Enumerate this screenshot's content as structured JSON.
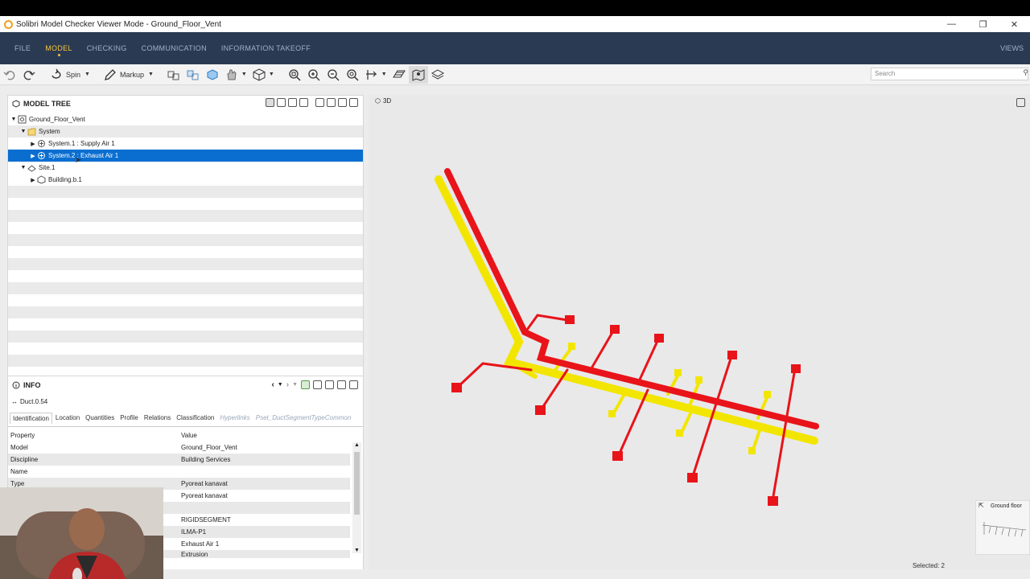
{
  "window": {
    "title": "Solibri Model Checker Viewer Mode - Ground_Floor_Vent"
  },
  "menu": {
    "items": [
      "FILE",
      "MODEL",
      "CHECKING",
      "COMMUNICATION",
      "INFORMATION TAKEOFF"
    ],
    "active": "MODEL",
    "views": "VIEWS"
  },
  "toolbar": {
    "spin": "Spin",
    "markup": "Markup",
    "search_placeholder": "Search"
  },
  "model_tree": {
    "title": "MODEL TREE",
    "rows": [
      {
        "label": "Ground_Floor_Vent",
        "toggle": "▼"
      },
      {
        "label": "System",
        "toggle": "▼"
      },
      {
        "label": "System.1 : Supply Air 1",
        "toggle": "▶"
      },
      {
        "label": "System.2 : Exhaust Air 1",
        "toggle": "▶"
      },
      {
        "label": "Site.1",
        "toggle": "▼"
      },
      {
        "label": "Building.b.1",
        "toggle": "▶"
      }
    ]
  },
  "info": {
    "title": "INFO",
    "object": "Duct.0.54",
    "tabs": [
      "Identification",
      "Location",
      "Quantities",
      "Profile",
      "Relations",
      "Classification",
      "Hyperlinks",
      "Pset_DuctSegmentTypeCommon"
    ],
    "header": {
      "property": "Property",
      "value": "Value"
    },
    "rows": [
      {
        "k": "Model",
        "v": "Ground_Floor_Vent"
      },
      {
        "k": "Discipline",
        "v": "Building Services"
      },
      {
        "k": "Name",
        "v": ""
      },
      {
        "k": "Type",
        "v": "Pyoreat kanavat"
      },
      {
        "k": "",
        "v": "Pyoreat kanavat"
      },
      {
        "k": "",
        "v": ""
      },
      {
        "k": "",
        "v": "RIGIDSEGMENT"
      },
      {
        "k": "",
        "v": "ILMA-P1"
      },
      {
        "k": "",
        "v": "Exhaust Air 1"
      },
      {
        "k": "",
        "v": "Extrusion"
      }
    ]
  },
  "viewport": {
    "label": "3D",
    "selected": "Selected: 2",
    "minimap_label": "Ground floor"
  },
  "colors": {
    "exhaust": "#e8141a",
    "supply": "#f2e600",
    "selection": "#0a6ed1",
    "menubar": "#2a3a52"
  }
}
